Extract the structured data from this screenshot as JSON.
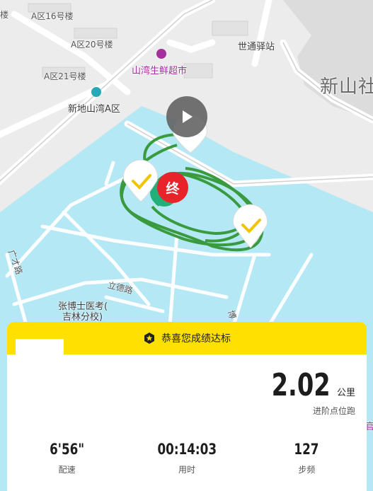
{
  "map": {
    "labels": {
      "building16": "A区16号楼",
      "building20": "A区20号楼",
      "building21": "A区21号楼",
      "supermarket": "山湾生鲜超市",
      "station": "世通驿站",
      "community": "新山社",
      "xindi": "新地山湾A区",
      "clinic_line1": "张博士医考(",
      "clinic_line2": "吉林分校)",
      "road_lide": "立德路",
      "road_guang": "广才路",
      "road_bo": "博",
      "edge_char": "官"
    },
    "route_color": "#3a9a3e",
    "water_color": "#b4e8f4",
    "end_marker_text": "终",
    "end_marker_color": "#e8242a",
    "start_marker_color": "#22b07a"
  },
  "card": {
    "banner_text": "恭喜您成绩达标",
    "banner_color": "#ffe000",
    "distance_value": "2.02",
    "distance_unit": "公里",
    "distance_label": "进阶点位跑",
    "stats": [
      {
        "value": "6'56\"",
        "label": "配速"
      },
      {
        "value": "00:14:03",
        "label": "用时"
      },
      {
        "value": "127",
        "label": "步频"
      }
    ]
  }
}
